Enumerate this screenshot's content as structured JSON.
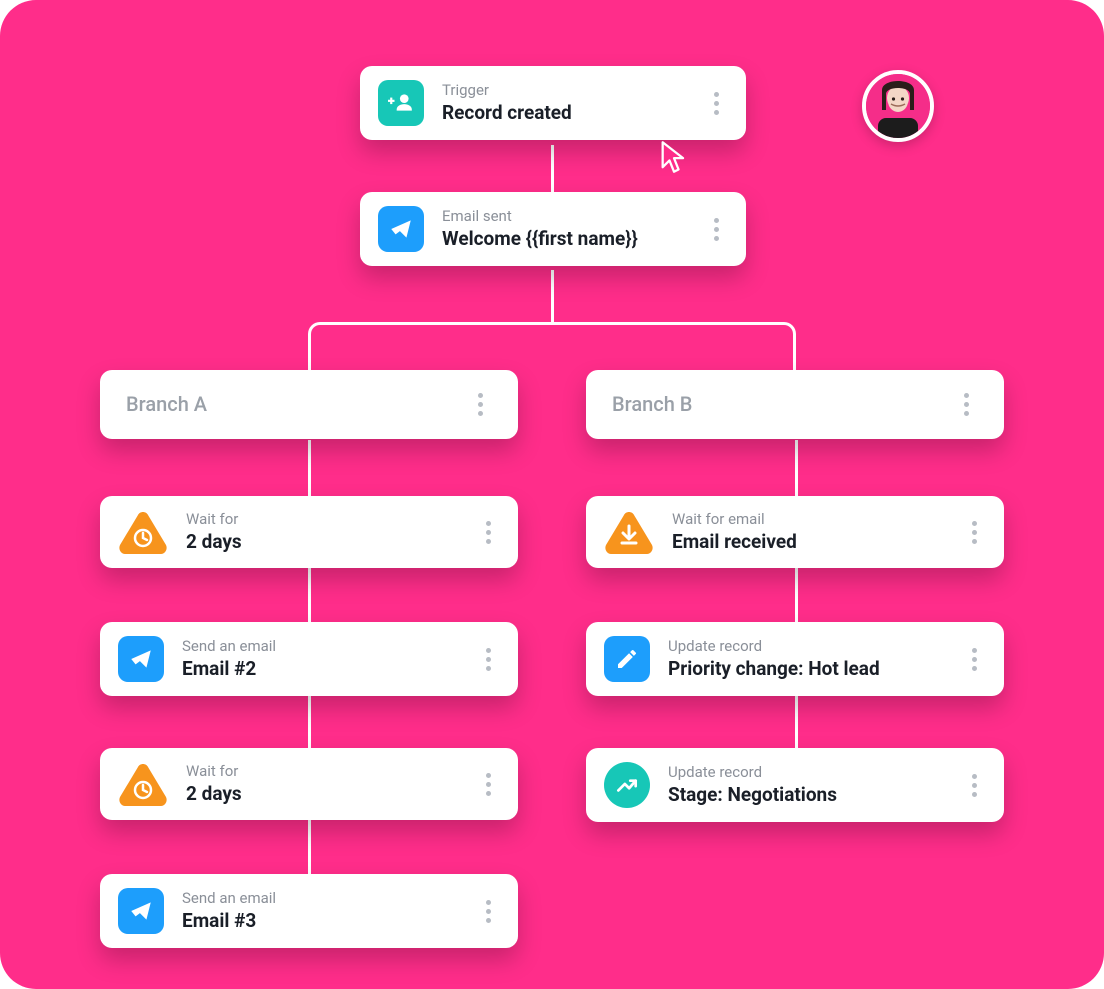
{
  "colors": {
    "background": "#ff2d8a",
    "teal": "#17c7b7",
    "blue": "#1d9efc",
    "orange": "#f7941d"
  },
  "trigger": {
    "label": "Trigger",
    "title": "Record created"
  },
  "email_sent": {
    "label": "Email sent",
    "title": "Welcome {{first name}}"
  },
  "branch_a": {
    "title": "Branch A"
  },
  "branch_b": {
    "title": "Branch B"
  },
  "a_wait1": {
    "label": "Wait for",
    "title": "2 days"
  },
  "a_send1": {
    "label": "Send an email",
    "title": "Email #2"
  },
  "a_wait2": {
    "label": "Wait for",
    "title": "2 days"
  },
  "a_send2": {
    "label": "Send an email",
    "title": "Email #3"
  },
  "b_wait_email": {
    "label": "Wait for email",
    "title": "Email received"
  },
  "b_update1": {
    "label": "Update record",
    "title": "Priority change: Hot lead"
  },
  "b_update2": {
    "label": "Update record",
    "title": "Stage: Negotiations"
  }
}
